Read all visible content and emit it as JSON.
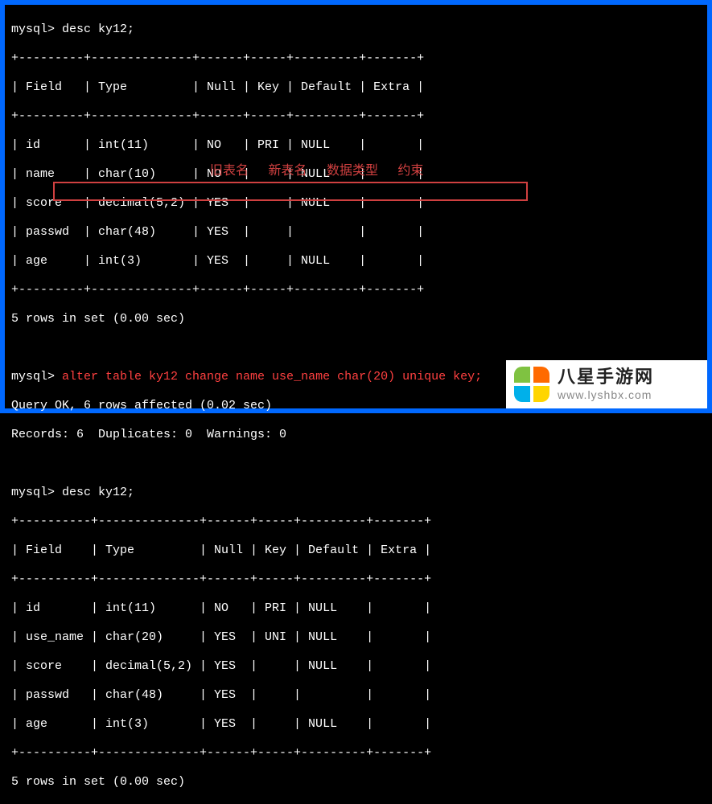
{
  "session": {
    "prompt1": "mysql> desc ky12;",
    "sep": "+---------+--------------+------+-----+---------+-------+",
    "header1": "| Field   | Type         | Null | Key | Default | Extra |",
    "row1a": "| id      | int(11)      | NO   | PRI | NULL    |       |",
    "row1b": "| name    | char(10)     | NO   |     | NULL    |       |",
    "row1c": "| score   | decimal(5,2) | YES  |     | NULL    |       |",
    "row1d": "| passwd  | char(48)     | YES  |     |         |       |",
    "row1e": "| age     | int(3)       | YES  |     | NULL    |       |",
    "result1": "5 rows in set (0.00 sec)",
    "prompt2_prefix": "mysql> ",
    "prompt2_cmd": "alter table ky12 change name use_name char(20) unique key;",
    "resp2a": "Query OK, 6 rows affected (0.02 sec)",
    "resp2b": "Records: 6  Duplicates: 0  Warnings: 0",
    "prompt3": "mysql> desc ky12;",
    "sep2": "+----------+--------------+------+-----+---------+-------+",
    "header2": "| Field    | Type         | Null | Key | Default | Extra |",
    "row2a": "| id       | int(11)      | NO   | PRI | NULL    |       |",
    "row2b": "| use_name | char(20)     | YES  | UNI | NULL    |       |",
    "row2c": "| score    | decimal(5,2) | YES  |     | NULL    |       |",
    "row2d": "| passwd   | char(48)     | YES  |     |         |       |",
    "row2e": "| age      | int(3)       | YES  |     | NULL    |       |",
    "result2": "5 rows in set (0.00 sec)"
  },
  "annotations": {
    "label1": "旧表名",
    "label2": "新表名",
    "label3": "数据类型",
    "label4": "约束"
  },
  "watermark": {
    "title": "八星手游网",
    "url": "www.lyshbx.com"
  }
}
